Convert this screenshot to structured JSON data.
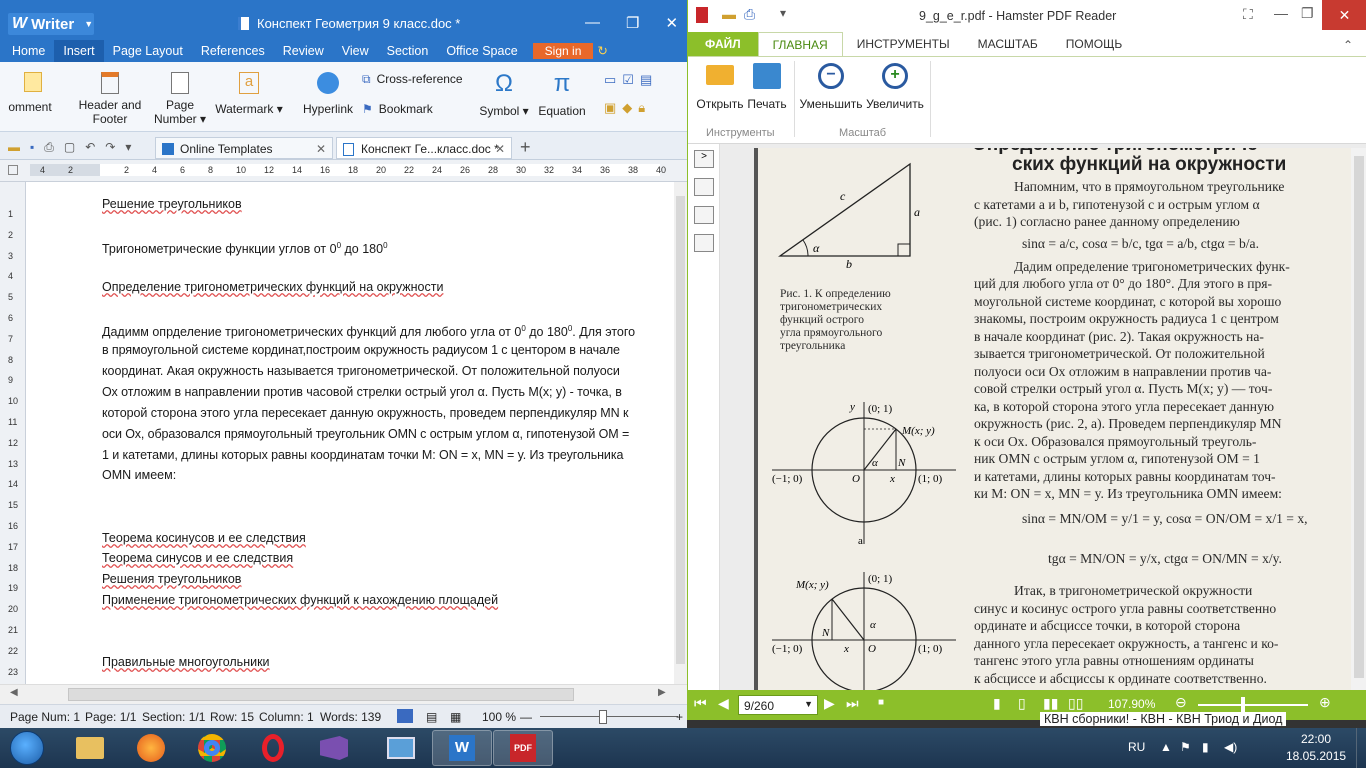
{
  "writer": {
    "app_name": "Writer",
    "doc_title": "Конспект Геометрия 9 класс.doc *",
    "menu": [
      "Home",
      "Insert",
      "Page Layout",
      "References",
      "Review",
      "View",
      "Section",
      "Office Space"
    ],
    "menu_active": "Insert",
    "sign_in": "Sign in",
    "ribbon": {
      "comment": "omment",
      "header_footer_1": "Header and",
      "header_footer_2": "Footer",
      "page_number_1": "Page",
      "page_number_2": "Number ▾",
      "watermark": "Watermark ▾",
      "hyperlink": "Hyperlink",
      "cross_reference": "Cross-reference",
      "bookmark": "Bookmark",
      "symbol": "Symbol ▾",
      "equation": "Equation"
    },
    "tabs": {
      "online_templates": "Online Templates",
      "doc_tab": "Конспект Ге...класс.doc *"
    },
    "ruler_top": [
      "4",
      "2",
      "",
      "2",
      "4",
      "6",
      "8",
      "10",
      "12",
      "14",
      "16",
      "18",
      "20",
      "22",
      "24",
      "26",
      "28",
      "30",
      "32",
      "34",
      "36",
      "38",
      "40"
    ],
    "ruler_left": [
      "1",
      "2",
      "3",
      "4",
      "5",
      "6",
      "7",
      "8",
      "9",
      "10",
      "11",
      "12",
      "13",
      "14",
      "15",
      "16",
      "17",
      "18",
      "19",
      "20",
      "21",
      "22",
      "23"
    ],
    "lines": {
      "l1": "Решение треугольников",
      "l2a": "Тригонометрические функции углов от 0",
      "l2b": "0",
      "l2c": " до 180",
      "l2d": "0",
      "l3": "Определение тригонометрических функций на окружности",
      "p1": "Дадимм опрделение тригонометрических функций для любого угла от 0",
      "p1s": "0",
      "p1b": " до 180",
      "p1c": ". Для этого",
      "p2": "в прямоугольной системе кординат,построим окружность радиусом 1 с центором в начале",
      "p3": "координат. Акая окружность называется тригонометрической. От положительной полуоси",
      "p4": "Ох отложим в направлении против часовой стрелки острый угол α. Пусть М(х; у) - точка, в",
      "p5": "которой сторона этого угла пересекает данную окружность, проведем перпендикуляр MN к",
      "p6": "оси Ох, образовался прямоугольный треугольник OMN с острым углом α, гипотенузой ОМ =",
      "p7": "1 и катетами, длины которых равны координатам точки М: ON = x, MN = y. Из треугольника",
      "p8": "OMN имеем:",
      "t1": "Теорема косинусов и ее следствия",
      "t2": "Теорема синусов и ее следствия",
      "t3": "Решения треугольников",
      "t4": "Применение тригонометрических функций к нахождению площадей",
      "t5": "Правильные многоугольники"
    },
    "status": {
      "page_num": "Page Num: 1",
      "page": "Page: 1/1",
      "section": "Section: 1/1",
      "row": "Row: 15",
      "column": "Column: 1",
      "words": "Words: 139",
      "zoom": "100 %"
    }
  },
  "pdf": {
    "title": "9_g_e_r.pdf - Hamster PDF Reader",
    "tabs": [
      "ФАЙЛ",
      "ГЛАВНАЯ",
      "ИНСТРУМЕНТЫ",
      "МАСШТАБ",
      "ПОМОЩЬ"
    ],
    "ribbon": {
      "open": "Открыть",
      "print": "Печать",
      "zoom_out": "Уменьшить",
      "zoom_in": "Увеличить",
      "group_tools": "Инструменты",
      "group_scale": "Масштаб"
    },
    "page_input": "9/260",
    "zoom": "107.90%",
    "content": {
      "h1": "Определение тригонометриче-",
      "h2": "ских функций на окружности",
      "fig1_c": "c",
      "fig1_a": "a",
      "fig1_b": "b",
      "fig1_alpha": "α",
      "cap1": "Рис. 1. К определению",
      "cap2": "тригонометрических",
      "cap3": "функций острого",
      "cap4": "угла прямоугольного",
      "cap5": "треугольника",
      "r1": "Напомним, что в прямоугольном треугольнике",
      "r2": "с катетами a и b, гипотенузой c и острым углом α",
      "r3": "(рис. 1) согласно ранее данному определению",
      "r4": "sinα = a/c,  cosα = b/c,  tgα = a/b,  ctgα = b/a.",
      "r5": "Дадим определение тригонометрических функ-",
      "r6": "ций для любого угла от 0° до 180°. Для этого в пря-",
      "r7": "моугольной системе координат, с которой вы хорошо",
      "r8": "знакомы, построим окружность радиуса 1 с центром",
      "r9": "в начале координат (рис. 2). Такая окружность на-",
      "r10": "зывается тригонометрической. От положительной",
      "r11": "полуоси оси Ox отложим в направлении против ча-",
      "r12": "совой стрелки острый угол α. Пусть M(x; y) — точ-",
      "r13": "ка, в которой сторона этого угла пересекает данную",
      "r14": "окружность (рис. 2, а). Проведем перпендикуляр MN",
      "r15": "к оси Ox. Образовался прямоугольный треуголь-",
      "r16": "ник OMN с острым углом α, гипотенузой OM = 1",
      "r17": "и катетами, длины которых равны координатам точ-",
      "r18": "ки M: ON = x, MN = y. Из треугольника OMN имеем:",
      "r19": "sinα = MN/OM = y/1 = y,  cosα = ON/OM = x/1 = x,",
      "r20": "tgα = MN/ON = y/x,  ctgα = ON/MN = x/y.",
      "r21": "Итак, в тригонометрической окружности",
      "r22": "синус и косинус острого угла равны соответственно",
      "r23": "ординате и абсциссе точки, в которой сторона",
      "r24": "данного угла пересекает окружность, а тангенс и ко-",
      "r25": "тангенс этого угла равны отношениям ординаты",
      "r26": "к абсциссе и абсциссы к ординате соответственно.",
      "fig2_y": "y",
      "fig2_01": "(0; 1)",
      "fig2_M": "M(x; y)",
      "fig2_m10": "(−1; 0)",
      "fig2_10": "(1; 0)",
      "fig2_O": "O",
      "fig2_N": "N",
      "fig2_x": "x",
      "fig2_a": "a",
      "fig2_alpha": "α"
    }
  },
  "background_text": "КВН сборники! - КВН - КВН Триод и Диод",
  "tray": {
    "lang": "RU",
    "time": "22:00",
    "date": "18.05.2015"
  },
  "colors": {
    "writer_blue": "#2b75c8",
    "pdf_green": "#8cbf2a",
    "signin_orange": "#e8682a"
  }
}
